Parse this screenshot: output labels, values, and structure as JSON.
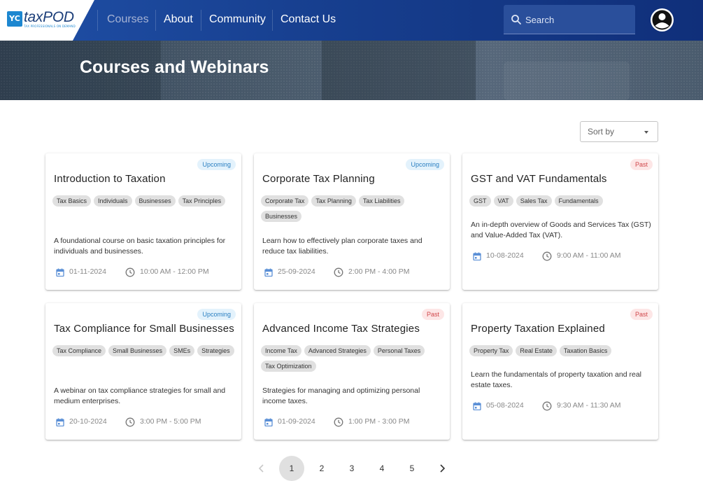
{
  "brand": {
    "logo_mark": "YC",
    "name": "taxPOD",
    "tagline": "TAX PROFESSIONALS ON DEMAND"
  },
  "nav": [
    {
      "label": "Courses",
      "active": true
    },
    {
      "label": "About"
    },
    {
      "label": "Community"
    },
    {
      "label": "Contact Us"
    }
  ],
  "search": {
    "placeholder": "Search"
  },
  "banner": {
    "title": "Courses and Webinars"
  },
  "sort": {
    "label": "Sort by"
  },
  "courses": [
    {
      "status": "Upcoming",
      "title": "Introduction to Taxation",
      "tags": [
        "Tax Basics",
        "Individuals",
        "Businesses",
        "Tax Principles"
      ],
      "description": "A foundational course on basic taxation principles for individuals and businesses.",
      "date": "01-11-2024",
      "time": "10:00 AM - 12:00 PM"
    },
    {
      "status": "Upcoming",
      "title": "Corporate Tax Planning",
      "tags": [
        "Corporate Tax",
        "Tax Planning",
        "Tax Liabilities",
        "Businesses"
      ],
      "description": "Learn how to effectively plan corporate taxes and reduce tax liabilities.",
      "date": "25-09-2024",
      "time": "2:00 PM - 4:00 PM"
    },
    {
      "status": "Past",
      "title": "GST and VAT Fundamentals",
      "tags": [
        "GST",
        "VAT",
        "Sales Tax",
        "Fundamentals"
      ],
      "description": "An in-depth overview of Goods and Services Tax (GST) and Value-Added Tax (VAT).",
      "date": "10-08-2024",
      "time": "9:00 AM - 11:00 AM"
    },
    {
      "status": "Upcoming",
      "title": "Tax Compliance for Small Businesses",
      "tags": [
        "Tax Compliance",
        "Small Businesses",
        "SMEs",
        "Strategies"
      ],
      "description": "A webinar on tax compliance strategies for small and medium enterprises.",
      "date": "20-10-2024",
      "time": "3:00 PM - 5:00 PM"
    },
    {
      "status": "Past",
      "title": "Advanced Income Tax Strategies",
      "tags": [
        "Income Tax",
        "Advanced Strategies",
        "Personal Taxes",
        "Tax Optimization"
      ],
      "description": "Strategies for managing and optimizing personal income taxes.",
      "date": "01-09-2024",
      "time": "1:00 PM - 3:00 PM"
    },
    {
      "status": "Past",
      "title": "Property Taxation Explained",
      "tags": [
        "Property Tax",
        "Real Estate",
        "Taxation Basics"
      ],
      "description": "Learn the fundamentals of property taxation and real estate taxes.",
      "date": "05-08-2024",
      "time": "9:30 AM - 11:30 AM"
    }
  ],
  "pagination": {
    "pages": [
      "1",
      "2",
      "3",
      "4",
      "5"
    ],
    "current": "1"
  },
  "colors": {
    "header": "#173f8f",
    "upcoming_badge": "#2a7fc1",
    "past_badge": "#d0474b",
    "icon": "#5a8fd6"
  }
}
